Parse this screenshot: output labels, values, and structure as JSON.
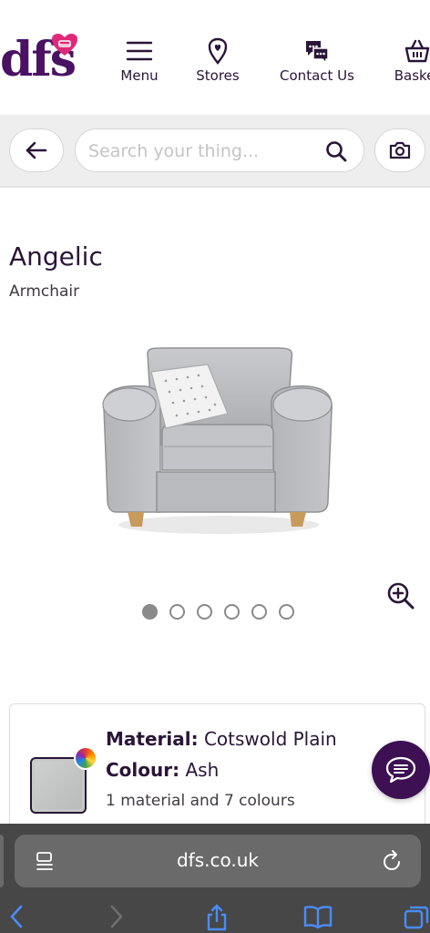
{
  "header": {
    "logo_text": "dfs",
    "nav": [
      {
        "label": "Menu",
        "icon": "menu-icon"
      },
      {
        "label": "Stores",
        "icon": "store-pin-icon"
      },
      {
        "label": "Contact Us",
        "icon": "chat-bubbles-icon"
      },
      {
        "label": "Basket",
        "icon": "basket-icon"
      }
    ]
  },
  "search": {
    "placeholder": "Search your thing..."
  },
  "product": {
    "name": "Angelic",
    "type": "Armchair",
    "carousel_total": 6,
    "carousel_active": 1
  },
  "material_card": {
    "material_label": "Material:",
    "material_value": "Cotswold Plain",
    "colour_label": "Colour:",
    "colour_value": "Ash",
    "summary": "1 material and 7 colours"
  },
  "browser": {
    "url": "dfs.co.uk"
  },
  "colors": {
    "brand_purple": "#4a1263",
    "chat_purple": "#3d0f53",
    "heart_pink": "#e0287a"
  }
}
